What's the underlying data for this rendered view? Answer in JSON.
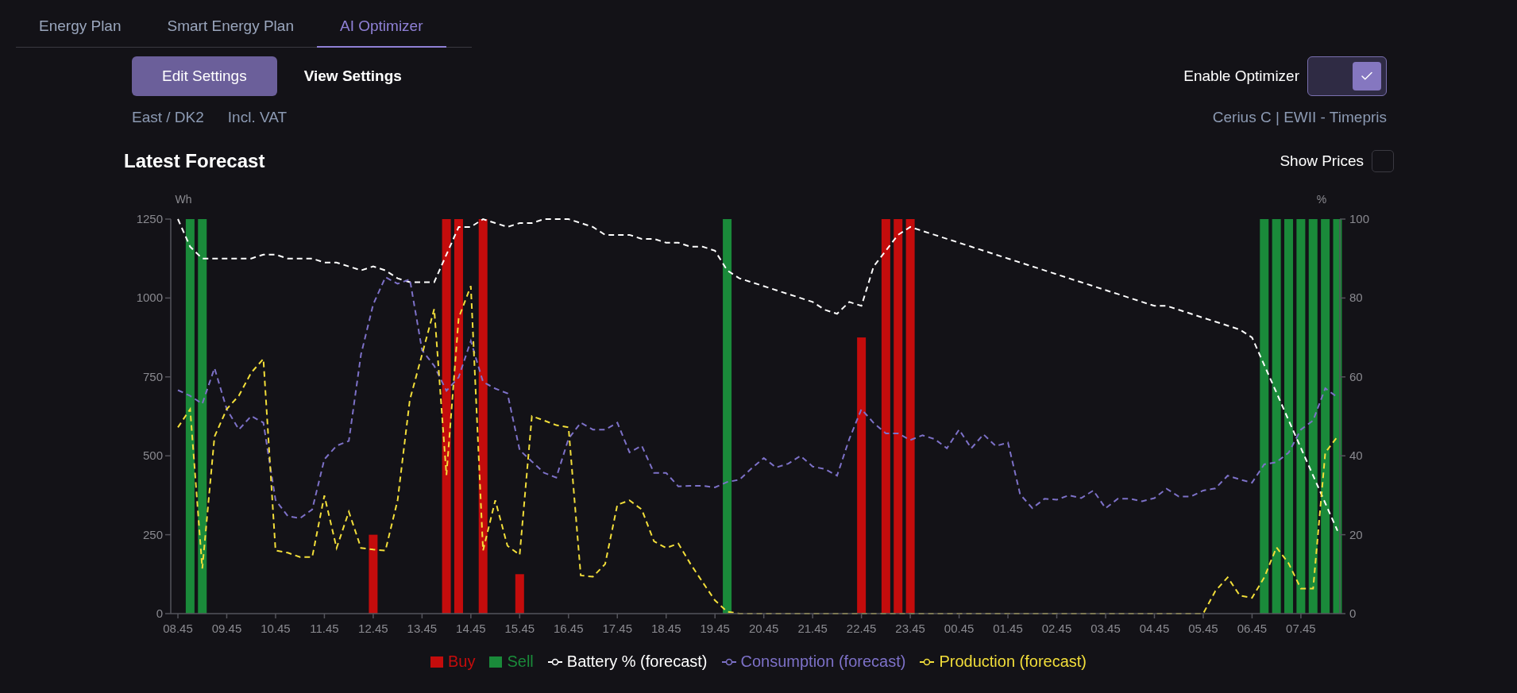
{
  "tabs": [
    {
      "label": "Energy Plan",
      "selected": false
    },
    {
      "label": "Smart Energy Plan",
      "selected": false
    },
    {
      "label": "AI Optimizer",
      "selected": true
    }
  ],
  "settings_views": [
    {
      "label": "Edit Settings",
      "selected": true
    },
    {
      "label": "View Settings",
      "selected": false
    }
  ],
  "optimizer": {
    "label": "Enable Optimizer",
    "enabled": true
  },
  "region": "East / DK2",
  "vat": "Incl. VAT",
  "tariff": "Cerius C | EWII - Timepris",
  "forecast": {
    "title": "Latest Forecast",
    "show_prices": {
      "label": "Show Prices",
      "checked": false
    },
    "chart_data": {
      "type": "bar",
      "ylabel": "Wh",
      "y2label": "%",
      "categories": [
        "08.45",
        null,
        null,
        null,
        "09.45",
        null,
        null,
        null,
        "10.45",
        null,
        null,
        null,
        "11.45",
        null,
        null,
        null,
        "12.45",
        null,
        null,
        null,
        "13.45",
        null,
        null,
        null,
        "14.45",
        null,
        null,
        null,
        "15.45",
        null,
        null,
        null,
        "16.45",
        null,
        null,
        null,
        "17.45",
        null,
        null,
        null,
        "18.45",
        null,
        null,
        null,
        "19.45",
        null,
        null,
        null,
        "20.45",
        null,
        null,
        null,
        "21.45",
        null,
        null,
        null,
        "22.45",
        null,
        null,
        null,
        "23.45",
        null,
        null,
        null,
        "00.45",
        null,
        null,
        null,
        "01.45",
        null,
        null,
        null,
        "02.45",
        null,
        null,
        null,
        "03.45",
        null,
        null,
        null,
        "04.45",
        null,
        null,
        null,
        "05.45",
        null,
        null,
        null,
        "06.45",
        null,
        null,
        null,
        "07.45",
        null,
        null,
        null
      ],
      "ylim": [
        0,
        1250
      ],
      "y2lim": [
        0,
        100
      ],
      "yticks": [
        0,
        250,
        500,
        750,
        1000,
        1250
      ],
      "y2ticks": [
        0,
        20,
        40,
        60,
        80,
        100
      ],
      "series": [
        {
          "name": "Buy",
          "type": "bar",
          "axis": "y",
          "color": "#c40c0c",
          "values": [
            null,
            null,
            null,
            null,
            null,
            null,
            null,
            null,
            null,
            null,
            null,
            null,
            null,
            null,
            null,
            null,
            250,
            null,
            null,
            null,
            null,
            null,
            1250,
            1250,
            null,
            1250,
            null,
            null,
            125,
            null,
            null,
            null,
            null,
            null,
            null,
            null,
            null,
            null,
            null,
            null,
            null,
            null,
            null,
            null,
            null,
            null,
            null,
            null,
            null,
            null,
            null,
            null,
            null,
            null,
            null,
            null,
            875,
            null,
            1250,
            1250,
            1250,
            null,
            null,
            null,
            null,
            null,
            null,
            null,
            null,
            null,
            null,
            null,
            null,
            null,
            null,
            null,
            null,
            null,
            null,
            null,
            null,
            null,
            null,
            null,
            null,
            null,
            null,
            null,
            null,
            null,
            null,
            null,
            null,
            null,
            null,
            null
          ]
        },
        {
          "name": "Sell",
          "type": "bar",
          "axis": "y",
          "color": "#1a8a3a",
          "values": [
            null,
            1250,
            1250,
            null,
            null,
            null,
            null,
            null,
            null,
            null,
            null,
            null,
            null,
            null,
            null,
            null,
            null,
            null,
            null,
            null,
            null,
            null,
            null,
            null,
            null,
            null,
            null,
            null,
            null,
            null,
            null,
            null,
            null,
            null,
            null,
            null,
            null,
            null,
            null,
            null,
            null,
            null,
            null,
            null,
            null,
            1250,
            null,
            null,
            null,
            null,
            null,
            null,
            null,
            null,
            null,
            null,
            null,
            null,
            null,
            null,
            null,
            null,
            null,
            null,
            null,
            null,
            null,
            null,
            null,
            null,
            null,
            null,
            null,
            null,
            null,
            null,
            null,
            null,
            null,
            null,
            null,
            null,
            null,
            null,
            null,
            null,
            null,
            null,
            null,
            1250,
            1250,
            1250,
            1250,
            1250,
            1250,
            1250
          ]
        },
        {
          "name": "Battery % (forecast)",
          "type": "line",
          "line_style": "dashed",
          "axis": "y2",
          "color": "#ffffff",
          "values": [
            100,
            93,
            90,
            90,
            90,
            90,
            90,
            91,
            91,
            90,
            90,
            90,
            89,
            89,
            88,
            87,
            88,
            87,
            85,
            84,
            84,
            84,
            91,
            98,
            98,
            100,
            99,
            98,
            99,
            99,
            100,
            100,
            100,
            99,
            98,
            96,
            96,
            96,
            95,
            95,
            94,
            94,
            93,
            93,
            92,
            87,
            85,
            84,
            83,
            82,
            81,
            80,
            79,
            77,
            76,
            79,
            78,
            88,
            92,
            96,
            98,
            97,
            96,
            95,
            94,
            93,
            92,
            91,
            90,
            89,
            88,
            87,
            86,
            85,
            84,
            83,
            82,
            81,
            80,
            79,
            78,
            78,
            77,
            76,
            75,
            74,
            73,
            72,
            70,
            63,
            56,
            49,
            42,
            35,
            28,
            21
          ]
        },
        {
          "name": "Consumption (forecast)",
          "type": "line",
          "line_style": "dashed",
          "axis": "y",
          "color": "#7d71c8",
          "values": [
            708,
            690,
            665,
            778,
            648,
            583,
            626,
            605,
            360,
            309,
            302,
            330,
            489,
            532,
            547,
            821,
            980,
            1066,
            1045,
            1059,
            835,
            785,
            706,
            749,
            864,
            734,
            713,
            698,
            518,
            482,
            446,
            431,
            554,
            605,
            583,
            583,
            605,
            511,
            532,
            446,
            446,
            403,
            405,
            405,
            400,
            417,
            424,
            460,
            493,
            463,
            475,
            500,
            466,
            458,
            437,
            553,
            648,
            604,
            571,
            571,
            550,
            565,
            553,
            524,
            583,
            524,
            568,
            531,
            542,
            378,
            334,
            364,
            361,
            375,
            366,
            390,
            334,
            364,
            364,
            356,
            366,
            396,
            371,
            371,
            390,
            397,
            437,
            425,
            415,
            473,
            480,
            510,
            583,
            612,
            714,
            685
          ]
        },
        {
          "name": "Production (forecast)",
          "type": "line",
          "line_style": "dashed",
          "axis": "y",
          "color": "#f2de3a",
          "values": [
            590,
            648,
            143,
            561,
            648,
            691,
            763,
            807,
            200,
            193,
            179,
            179,
            374,
            208,
            323,
            208,
            203,
            200,
            359,
            677,
            821,
            965,
            439,
            937,
            1038,
            200,
            359,
            215,
            186,
            626,
            612,
            597,
            590,
            121,
            117,
            157,
            345,
            359,
            330,
            229,
            208,
            222,
            157,
            99,
            42,
            6,
            0,
            0,
            0,
            0,
            0,
            0,
            0,
            0,
            0,
            0,
            0,
            0,
            0,
            0,
            0,
            0,
            0,
            0,
            0,
            0,
            0,
            0,
            0,
            0,
            0,
            0,
            0,
            0,
            0,
            0,
            0,
            0,
            0,
            0,
            0,
            0,
            0,
            0,
            0,
            72,
            115,
            57,
            50,
            115,
            210,
            159,
            79,
            79,
            510,
            561
          ]
        }
      ]
    }
  }
}
